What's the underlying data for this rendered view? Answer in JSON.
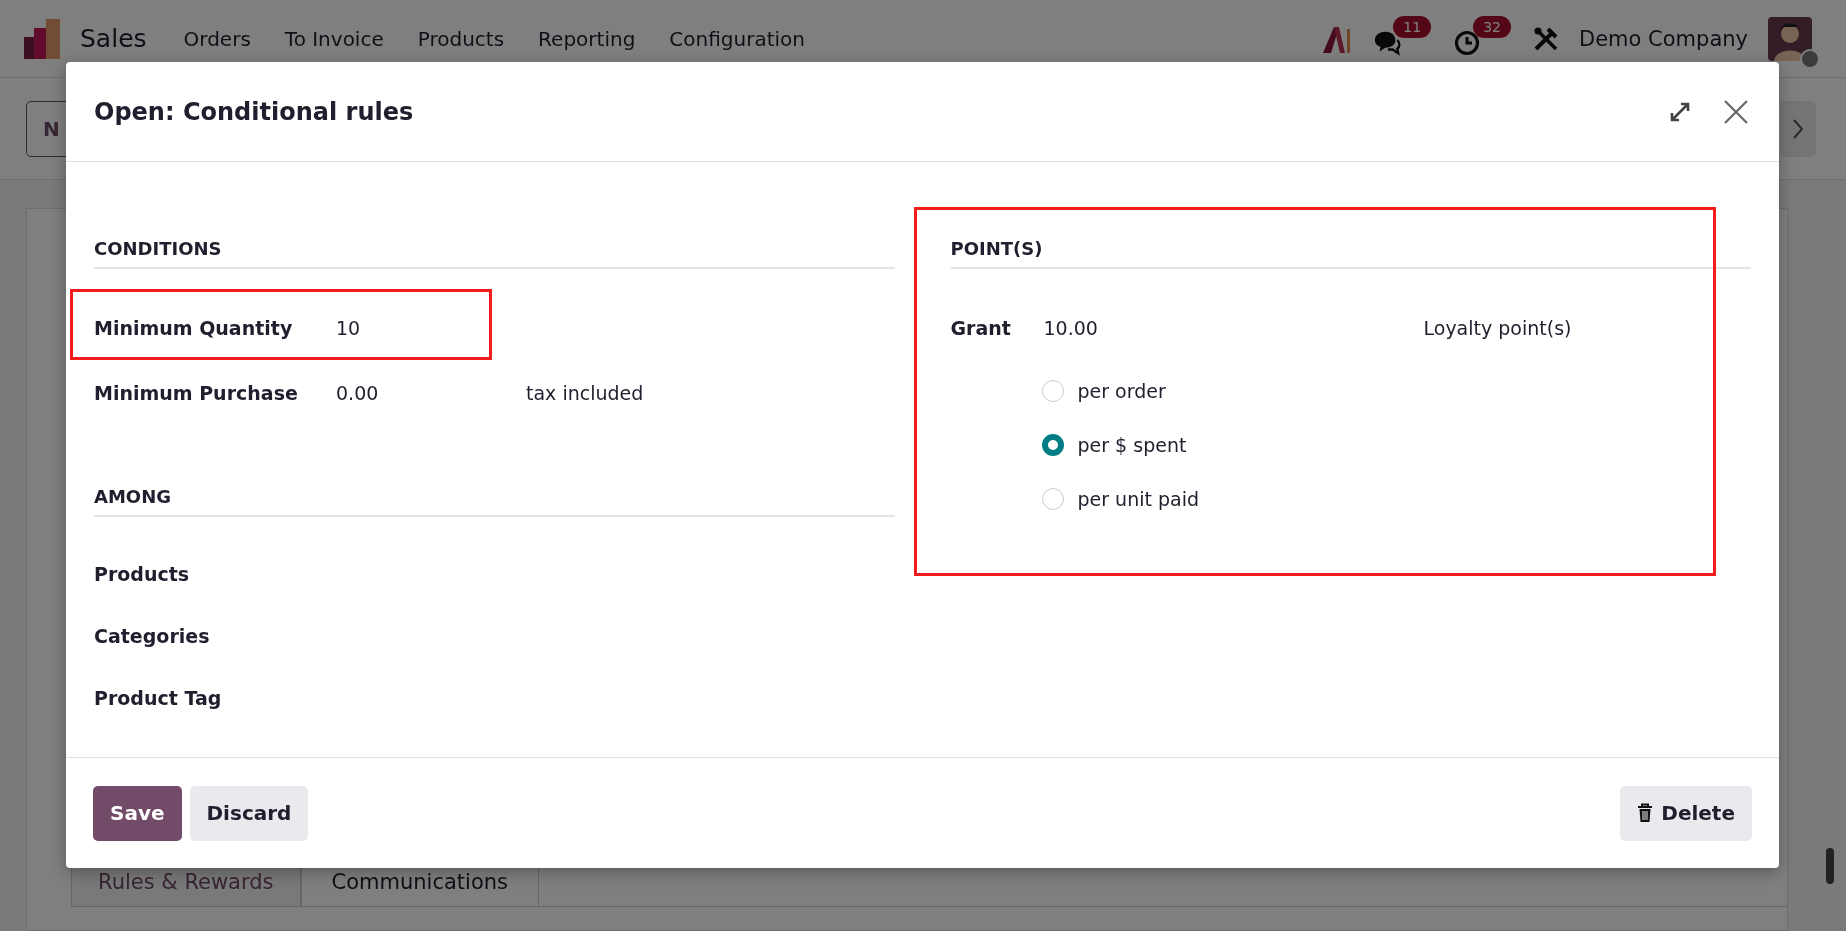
{
  "navbar": {
    "app_name": "Sales",
    "menu_items": [
      "Orders",
      "To Invoice",
      "Products",
      "Reporting",
      "Configuration"
    ],
    "messages_count": "11",
    "activities_count": "32",
    "company": "Demo Company"
  },
  "background": {
    "new_button": "N",
    "tabs": [
      {
        "label": "Rules & Rewards",
        "selected": false
      },
      {
        "label": "Communications",
        "selected": true
      }
    ]
  },
  "dialog": {
    "title": "Open: Conditional rules",
    "conditions": {
      "heading": "CONDITIONS",
      "fields": [
        {
          "label": "Minimum Quantity",
          "value": "10",
          "highlighted": true
        },
        {
          "label": "Minimum Purchase",
          "value": "0.00",
          "suffix": "tax included",
          "highlighted": false
        }
      ]
    },
    "among": {
      "heading": "AMONG",
      "fields": [
        {
          "label": "Products"
        },
        {
          "label": "Categories"
        },
        {
          "label": "Product Tag"
        }
      ]
    },
    "points": {
      "heading": "POINT(S)",
      "highlighted": true,
      "grant_label": "Grant",
      "grant_value": "10.00",
      "unit": "Loyalty point(s)",
      "options": [
        {
          "label": "per order",
          "selected": false
        },
        {
          "label": "per $ spent",
          "selected": true
        },
        {
          "label": "per unit paid",
          "selected": false
        }
      ]
    },
    "buttons": [
      {
        "label": "Save",
        "kind": "primary"
      },
      {
        "label": "Discard",
        "kind": "secondary"
      }
    ],
    "delete_button": "Delete"
  }
}
